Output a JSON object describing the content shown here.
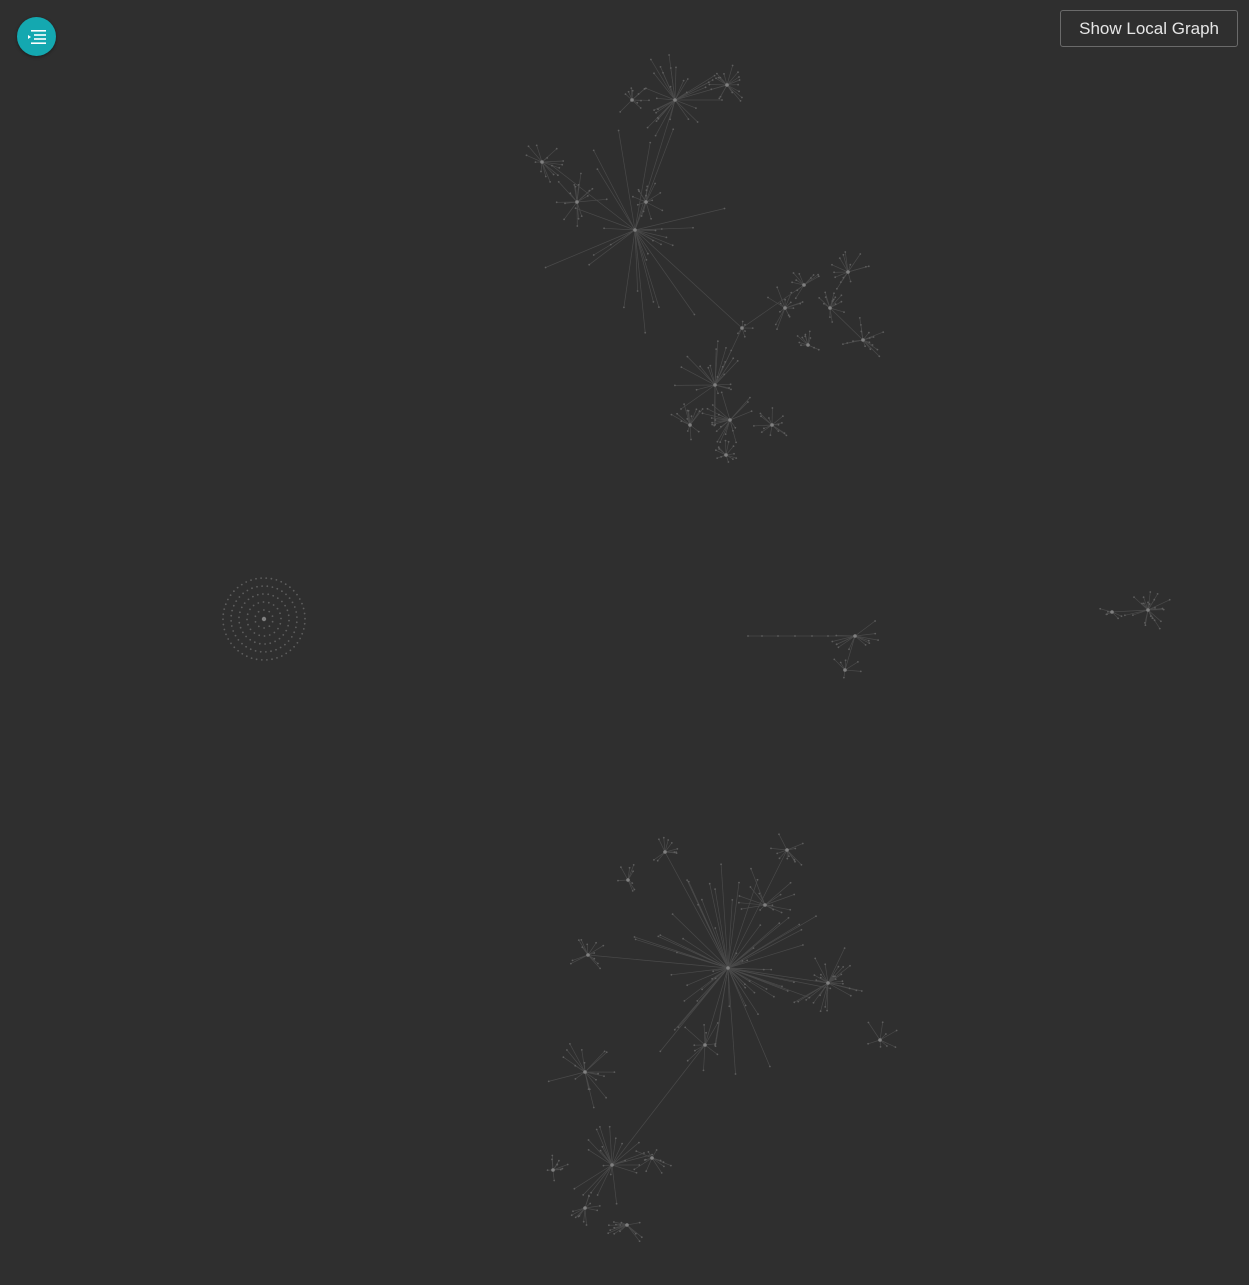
{
  "toolbar": {
    "menu_icon": "outline-list-icon",
    "local_graph_label": "Show Local Graph"
  },
  "graph": {
    "background_color": "#2f2f2f",
    "accent_color": "#14a8b0",
    "edge_color": "#4a4a4a",
    "node_color": "#5e5e5e"
  }
}
